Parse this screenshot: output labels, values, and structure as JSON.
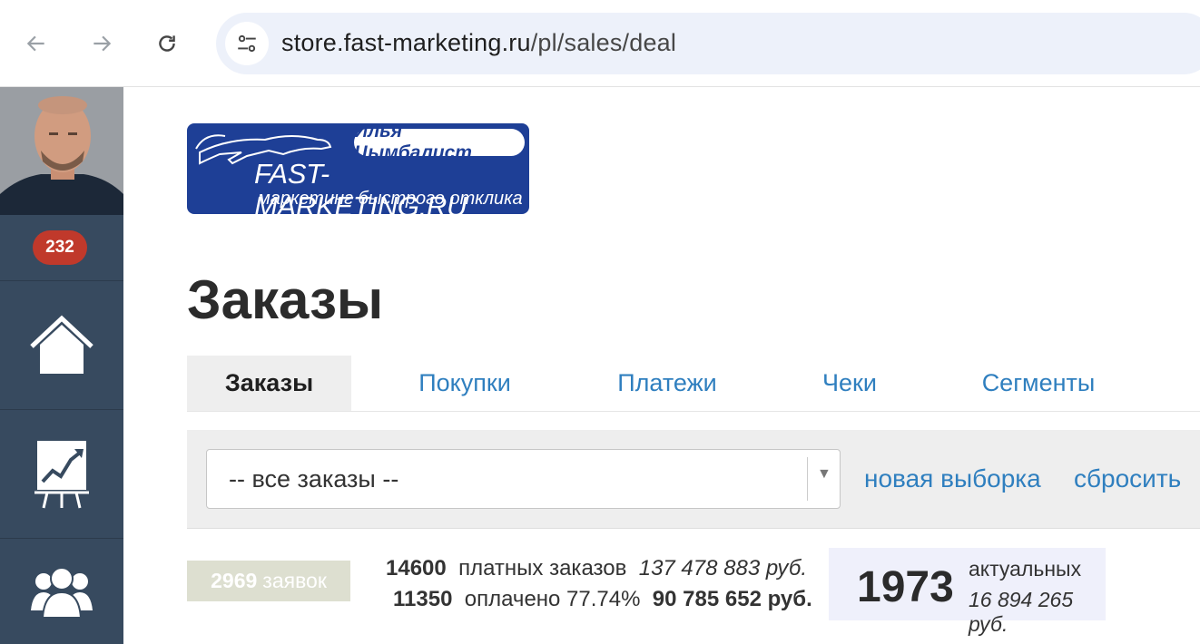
{
  "browser": {
    "url_host": "store.fast-marketing.ru",
    "url_path": "/pl/sales/deal"
  },
  "sidebar": {
    "notification_count": "232",
    "items": [
      {
        "icon": "home-icon"
      },
      {
        "icon": "chart-icon"
      },
      {
        "icon": "users-icon"
      }
    ]
  },
  "logo": {
    "author": "Илья Цымбалист",
    "brand": "FAST-MARKETING.RU",
    "tagline": "маркетинг быстрого отклика"
  },
  "page": {
    "title": "Заказы"
  },
  "tabs": [
    {
      "label": "Заказы",
      "active": true
    },
    {
      "label": "Покупки",
      "active": false
    },
    {
      "label": "Платежи",
      "active": false
    },
    {
      "label": "Чеки",
      "active": false
    },
    {
      "label": "Сегменты",
      "active": false
    }
  ],
  "filter": {
    "selected": "-- все заказы --",
    "new_selection_label": "новая выборка",
    "reset_label": "сбросить"
  },
  "stats": {
    "requests_count": "2969",
    "requests_label": "заявок",
    "paid_orders_count": "14600",
    "paid_orders_label": "платных заказов",
    "paid_orders_sum": "137 478 883 руб.",
    "paid_count": "11350",
    "paid_label": "оплачено 77.74%",
    "paid_sum": "90 785 652 руб.",
    "actual_count": "1973",
    "actual_label": "актуальных",
    "actual_sum": "16 894 265 руб."
  },
  "colors": {
    "sidebar": "#374a5f",
    "link": "#2f7fbf",
    "badge": "#c0392b",
    "logo_bg": "#1e3f96"
  }
}
